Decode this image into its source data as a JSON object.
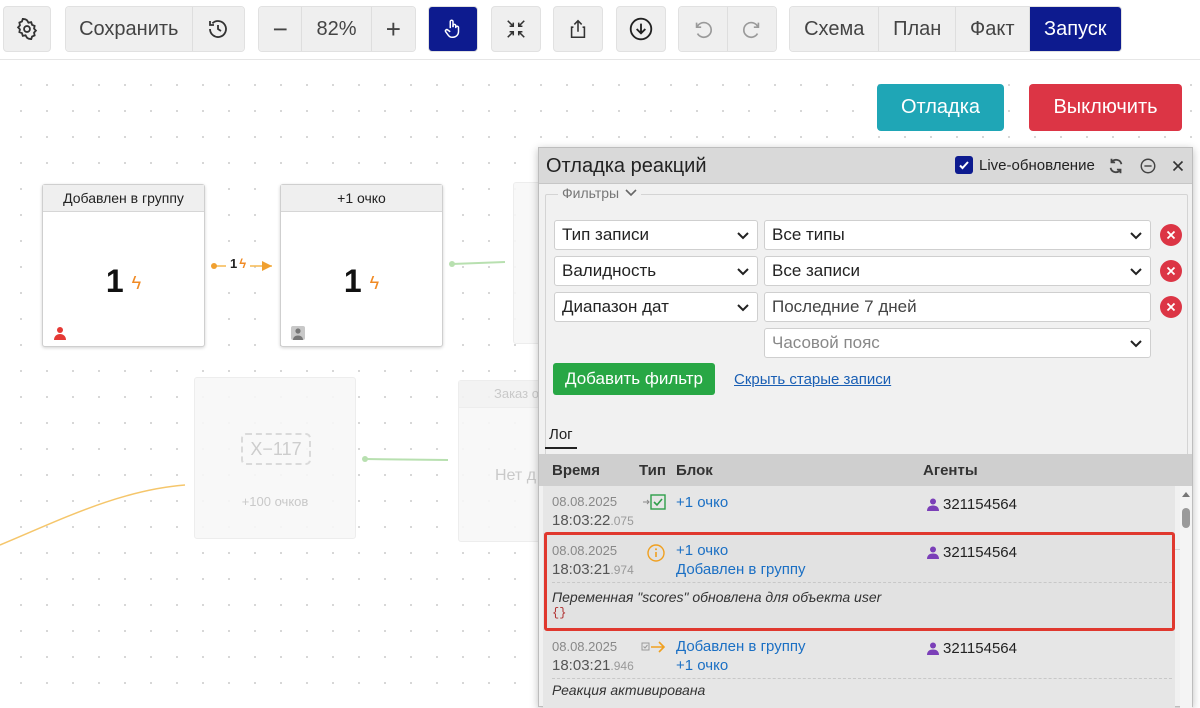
{
  "toolbar": {
    "save_label": "Сохранить",
    "zoom_value": "82%",
    "zoom_minus": "−",
    "zoom_plus": "+",
    "view_tabs": [
      "Схема",
      "План",
      "Факт",
      "Запуск"
    ],
    "active_view": "Запуск",
    "icons": [
      "gear-icon",
      "history-icon",
      "pointer-hand-icon",
      "collapse-arrows-icon",
      "share-icon",
      "download-icon",
      "undo-icon",
      "redo-icon"
    ]
  },
  "actions": {
    "debug_label": "Отладка",
    "off_label": "Выключить",
    "debug_color": "#1fa6b6",
    "off_color": "#dc3545"
  },
  "canvas": {
    "nodes": [
      {
        "title": "Добавлен в группу",
        "count": "1"
      },
      {
        "title": "+1 очко",
        "count": "1"
      }
    ],
    "edge_count": "1",
    "ghost_counter": "X−117",
    "ghost_label": "+100 очков",
    "ghost_title": "Заказ о",
    "ghost_empty": "Нет д"
  },
  "debug_panel": {
    "title": "Отладка реакций",
    "live_label": "Live-обновление",
    "live_checked": true,
    "filters_label": "Фильтры",
    "filters": [
      {
        "field": "Тип записи",
        "value": "Все типы"
      },
      {
        "field": "Валидность",
        "value": "Все записи"
      },
      {
        "field": "Диапазон дат",
        "value": "Последние 7 дней"
      }
    ],
    "timezone_placeholder": "Часовой пояс",
    "add_filter_label": "Добавить фильтр",
    "hide_old_label": "Скрыть старые записи",
    "tab_log": "Лог",
    "columns": {
      "time": "Время",
      "type": "Тип",
      "block": "Блок",
      "agents": "Агенты"
    },
    "rows": [
      {
        "date": "08.08.2025",
        "time": "18:03:22",
        "ms": ".075",
        "type_icon": "arrow-check-icon",
        "blocks": [
          "+1 очко"
        ],
        "agent": "321154564",
        "message": "",
        "code": ""
      },
      {
        "date": "08.08.2025",
        "time": "18:03:21",
        "ms": ".974",
        "type_icon": "info-icon",
        "blocks": [
          "+1 очко",
          "Добавлен в группу"
        ],
        "agent": "321154564",
        "message": "Переменная \"scores\" обновлена для объекта user",
        "code": "{}"
      },
      {
        "date": "08.08.2025",
        "time": "18:03:21",
        "ms": ".946",
        "type_icon": "arrow-right-icon",
        "blocks": [
          "Добавлен в группу",
          "+1 очко"
        ],
        "agent": "321154564",
        "message": "Реакция активирована",
        "code": ""
      }
    ]
  }
}
